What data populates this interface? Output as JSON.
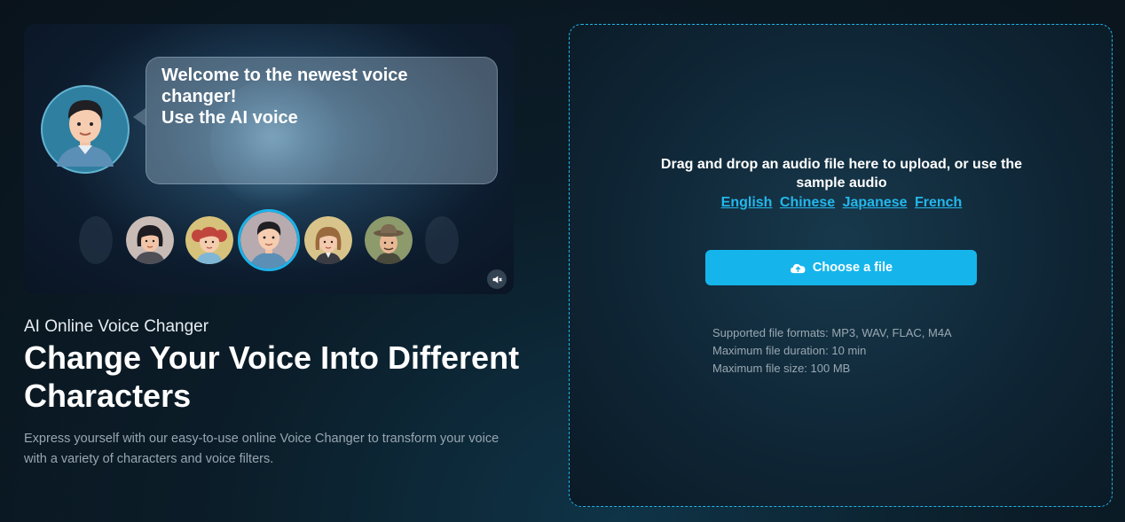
{
  "video": {
    "bubble_lines": [
      "Welcome to the newest voice changer!",
      "Use the AI voice"
    ],
    "speaker_icon": "man-avatar-icon",
    "characters": [
      "dark-haired-girl",
      "red-haired-girl",
      "man-selected",
      "blonde-woman",
      "explorer-man"
    ],
    "mute_icon": "speaker-muted-icon"
  },
  "hero": {
    "eyebrow": "AI Online Voice Changer",
    "headline": "Change Your Voice Into Different Characters",
    "description": "Express yourself with our easy-to-use online Voice Changer to transform your voice with a variety of characters and voice filters."
  },
  "upload": {
    "prompt_lines": [
      "Drag and drop an audio file here to upload, or use the",
      "sample audio"
    ],
    "sample_links": [
      "English",
      "Chinese",
      "Japanese",
      "French"
    ],
    "choose_button": "Choose a file",
    "choose_icon": "cloud-upload-icon",
    "specs": [
      "Supported file formats: MP3, WAV, FLAC, M4A",
      "Maximum file duration: 10 min",
      "Maximum file size: 100 MB"
    ]
  },
  "colors": {
    "accent": "#15b5ec",
    "link": "#24b7ec",
    "dashed_border": "#1fb7ea"
  }
}
